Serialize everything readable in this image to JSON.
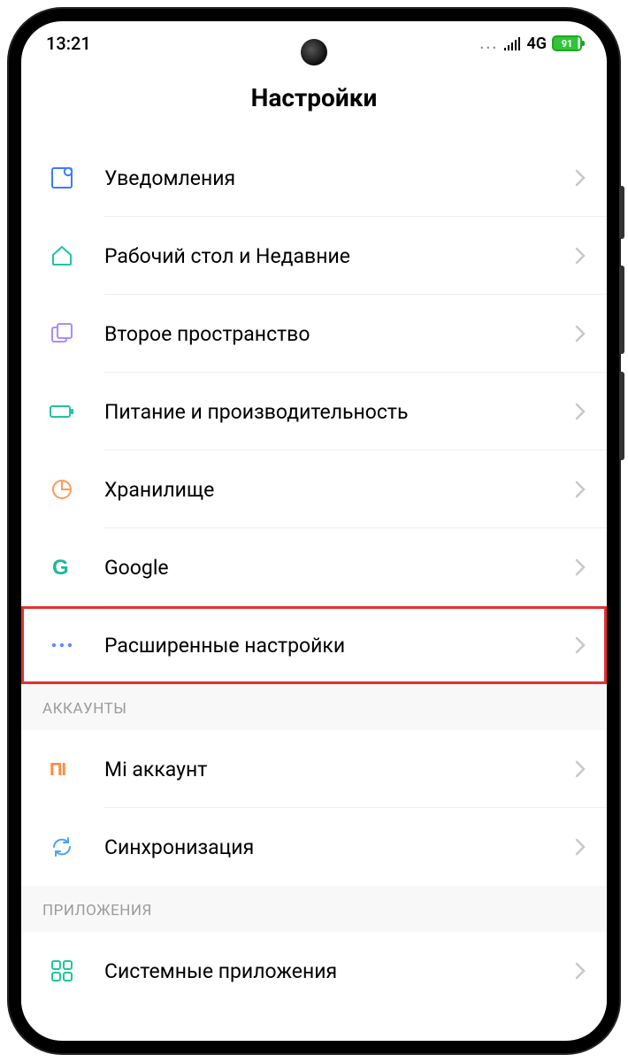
{
  "status_bar": {
    "time": "13:21",
    "network_dots": "...",
    "network_type": "4G",
    "battery_percent": "91"
  },
  "page_title": "Настройки",
  "sections": [
    {
      "items": [
        {
          "icon": "notification-icon",
          "label": "Уведомления",
          "highlight": false
        },
        {
          "icon": "home-icon",
          "label": "Рабочий стол и Недавние",
          "highlight": false
        },
        {
          "icon": "second-space-icon",
          "label": "Второе пространство",
          "highlight": false
        },
        {
          "icon": "battery-performance-icon",
          "label": "Питание и производительность",
          "highlight": false
        },
        {
          "icon": "storage-icon",
          "label": "Хранилище",
          "highlight": false
        },
        {
          "icon": "google-icon",
          "label": "Google",
          "highlight": false
        },
        {
          "icon": "more-icon",
          "label": "Расширенные настройки",
          "highlight": true
        }
      ]
    },
    {
      "header": "АККАУНТЫ",
      "items": [
        {
          "icon": "mi-icon",
          "label": "Mi аккаунт",
          "highlight": false
        },
        {
          "icon": "sync-icon",
          "label": "Синхронизация",
          "highlight": false
        }
      ]
    },
    {
      "header": "ПРИЛОЖЕНИЯ",
      "items": [
        {
          "icon": "apps-icon",
          "label": "Системные приложения",
          "highlight": false
        }
      ]
    }
  ]
}
